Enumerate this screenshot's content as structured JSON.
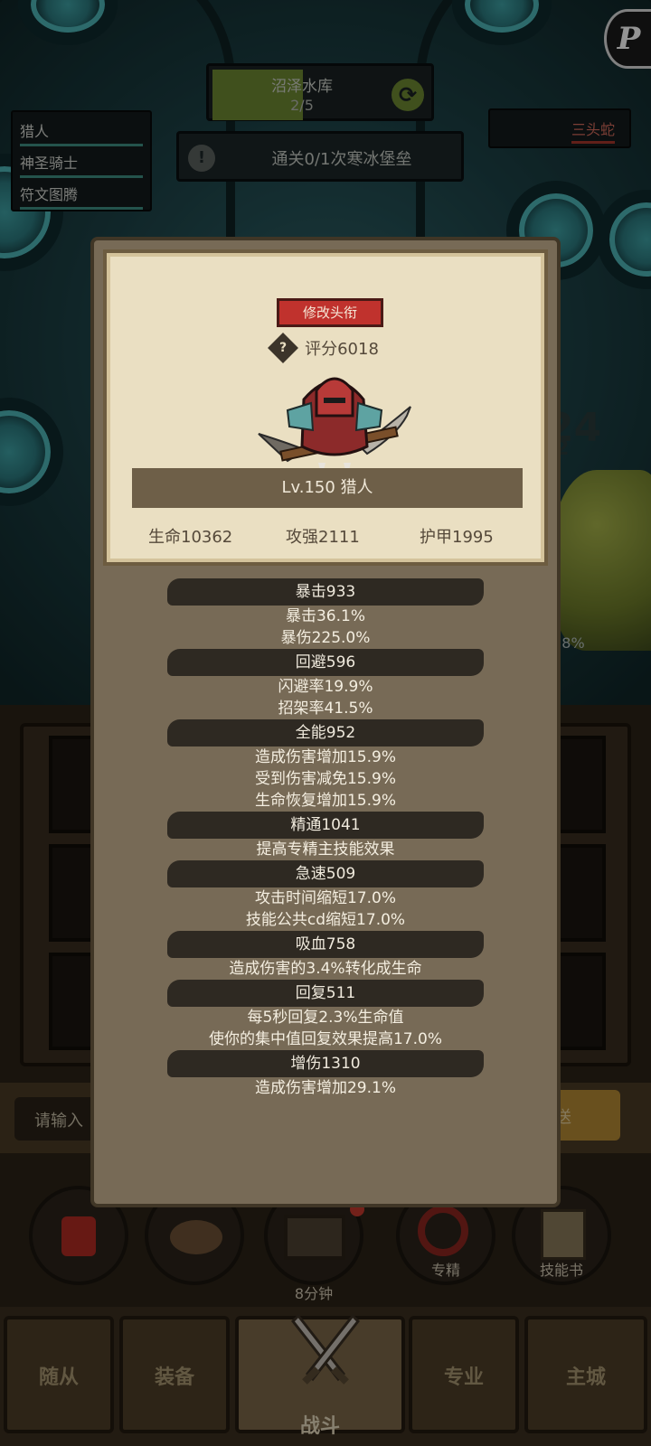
{
  "stage": {
    "name": "沼泽水库",
    "progress": "2/5"
  },
  "quest": {
    "text": "通关0/1次寒冰堡垒"
  },
  "party": [
    "猎人",
    "神圣骑士",
    "符文图腾"
  ],
  "enemy": {
    "name": "三头蛇"
  },
  "background_peek": {
    "number": "24",
    "sub_number": "2",
    "percent": "9.8%"
  },
  "chat": {
    "input_placeholder": "请输入",
    "send_label": "送"
  },
  "action_buttons": [
    {
      "icon": "potion-icon",
      "label": ""
    },
    {
      "icon": "bread-icon",
      "label": ""
    },
    {
      "icon": "chest-icon",
      "label": "8分钟"
    },
    {
      "icon": "target-icon",
      "label": "专精"
    },
    {
      "icon": "skill-book-icon",
      "label": "技能书"
    }
  ],
  "nav": [
    "随从",
    "装备",
    "战斗",
    "专业",
    "主城"
  ],
  "nav_active": "战斗",
  "modal": {
    "title_button": "修改头衔",
    "score": "评分6018",
    "level_line": "Lv.150 猎人",
    "base_stats": {
      "hp": "生命10362",
      "attack": "攻强2111",
      "armor": "护甲1995"
    },
    "categories": [
      {
        "header": "暴击933",
        "lines": [
          "暴击36.1%",
          "暴伤225.0%"
        ]
      },
      {
        "header": "回避596",
        "lines": [
          "闪避率19.9%",
          "招架率41.5%"
        ]
      },
      {
        "header": "全能952",
        "lines": [
          "造成伤害增加15.9%",
          "受到伤害减免15.9%",
          "生命恢复增加15.9%"
        ]
      },
      {
        "header": "精通1041",
        "lines": [
          "提高专精主技能效果"
        ]
      },
      {
        "header": "急速509",
        "lines": [
          "攻击时间缩短17.0%",
          "技能公共cd缩短17.0%"
        ]
      },
      {
        "header": "吸血758",
        "lines": [
          "造成伤害的3.4%转化成生命"
        ]
      },
      {
        "header": "回复511",
        "lines": [
          "每5秒回复2.3%生命值",
          "使你的集中值回复效果提高17.0%"
        ]
      },
      {
        "header": "增伤1310",
        "lines": [
          "造成伤害增加29.1%"
        ]
      }
    ]
  },
  "colors": {
    "modal_bg": "#776a56",
    "parchment": "#eadfc2",
    "title_button": "#c0322d",
    "category_bar": "#2e2922"
  }
}
